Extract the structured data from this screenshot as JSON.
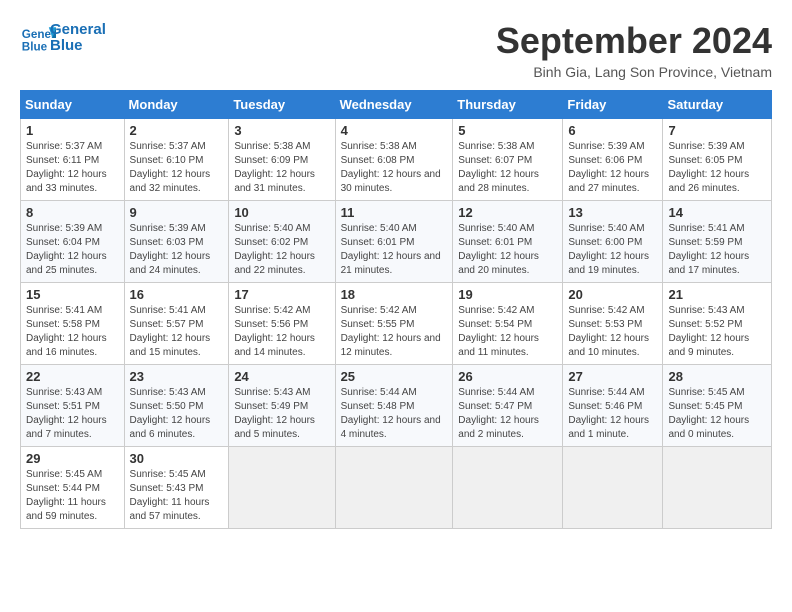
{
  "header": {
    "logo_line1": "General",
    "logo_line2": "Blue",
    "month_title": "September 2024",
    "location": "Binh Gia, Lang Son Province, Vietnam"
  },
  "days_of_week": [
    "Sunday",
    "Monday",
    "Tuesday",
    "Wednesday",
    "Thursday",
    "Friday",
    "Saturday"
  ],
  "weeks": [
    [
      {
        "day": "1",
        "sunrise": "5:37 AM",
        "sunset": "6:11 PM",
        "daylight": "12 hours and 33 minutes."
      },
      {
        "day": "2",
        "sunrise": "5:37 AM",
        "sunset": "6:10 PM",
        "daylight": "12 hours and 32 minutes."
      },
      {
        "day": "3",
        "sunrise": "5:38 AM",
        "sunset": "6:09 PM",
        "daylight": "12 hours and 31 minutes."
      },
      {
        "day": "4",
        "sunrise": "5:38 AM",
        "sunset": "6:08 PM",
        "daylight": "12 hours and 30 minutes."
      },
      {
        "day": "5",
        "sunrise": "5:38 AM",
        "sunset": "6:07 PM",
        "daylight": "12 hours and 28 minutes."
      },
      {
        "day": "6",
        "sunrise": "5:39 AM",
        "sunset": "6:06 PM",
        "daylight": "12 hours and 27 minutes."
      },
      {
        "day": "7",
        "sunrise": "5:39 AM",
        "sunset": "6:05 PM",
        "daylight": "12 hours and 26 minutes."
      }
    ],
    [
      {
        "day": "8",
        "sunrise": "5:39 AM",
        "sunset": "6:04 PM",
        "daylight": "12 hours and 25 minutes."
      },
      {
        "day": "9",
        "sunrise": "5:39 AM",
        "sunset": "6:03 PM",
        "daylight": "12 hours and 24 minutes."
      },
      {
        "day": "10",
        "sunrise": "5:40 AM",
        "sunset": "6:02 PM",
        "daylight": "12 hours and 22 minutes."
      },
      {
        "day": "11",
        "sunrise": "5:40 AM",
        "sunset": "6:01 PM",
        "daylight": "12 hours and 21 minutes."
      },
      {
        "day": "12",
        "sunrise": "5:40 AM",
        "sunset": "6:01 PM",
        "daylight": "12 hours and 20 minutes."
      },
      {
        "day": "13",
        "sunrise": "5:40 AM",
        "sunset": "6:00 PM",
        "daylight": "12 hours and 19 minutes."
      },
      {
        "day": "14",
        "sunrise": "5:41 AM",
        "sunset": "5:59 PM",
        "daylight": "12 hours and 17 minutes."
      }
    ],
    [
      {
        "day": "15",
        "sunrise": "5:41 AM",
        "sunset": "5:58 PM",
        "daylight": "12 hours and 16 minutes."
      },
      {
        "day": "16",
        "sunrise": "5:41 AM",
        "sunset": "5:57 PM",
        "daylight": "12 hours and 15 minutes."
      },
      {
        "day": "17",
        "sunrise": "5:42 AM",
        "sunset": "5:56 PM",
        "daylight": "12 hours and 14 minutes."
      },
      {
        "day": "18",
        "sunrise": "5:42 AM",
        "sunset": "5:55 PM",
        "daylight": "12 hours and 12 minutes."
      },
      {
        "day": "19",
        "sunrise": "5:42 AM",
        "sunset": "5:54 PM",
        "daylight": "12 hours and 11 minutes."
      },
      {
        "day": "20",
        "sunrise": "5:42 AM",
        "sunset": "5:53 PM",
        "daylight": "12 hours and 10 minutes."
      },
      {
        "day": "21",
        "sunrise": "5:43 AM",
        "sunset": "5:52 PM",
        "daylight": "12 hours and 9 minutes."
      }
    ],
    [
      {
        "day": "22",
        "sunrise": "5:43 AM",
        "sunset": "5:51 PM",
        "daylight": "12 hours and 7 minutes."
      },
      {
        "day": "23",
        "sunrise": "5:43 AM",
        "sunset": "5:50 PM",
        "daylight": "12 hours and 6 minutes."
      },
      {
        "day": "24",
        "sunrise": "5:43 AM",
        "sunset": "5:49 PM",
        "daylight": "12 hours and 5 minutes."
      },
      {
        "day": "25",
        "sunrise": "5:44 AM",
        "sunset": "5:48 PM",
        "daylight": "12 hours and 4 minutes."
      },
      {
        "day": "26",
        "sunrise": "5:44 AM",
        "sunset": "5:47 PM",
        "daylight": "12 hours and 2 minutes."
      },
      {
        "day": "27",
        "sunrise": "5:44 AM",
        "sunset": "5:46 PM",
        "daylight": "12 hours and 1 minute."
      },
      {
        "day": "28",
        "sunrise": "5:45 AM",
        "sunset": "5:45 PM",
        "daylight": "12 hours and 0 minutes."
      }
    ],
    [
      {
        "day": "29",
        "sunrise": "5:45 AM",
        "sunset": "5:44 PM",
        "daylight": "11 hours and 59 minutes."
      },
      {
        "day": "30",
        "sunrise": "5:45 AM",
        "sunset": "5:43 PM",
        "daylight": "11 hours and 57 minutes."
      },
      null,
      null,
      null,
      null,
      null
    ]
  ]
}
